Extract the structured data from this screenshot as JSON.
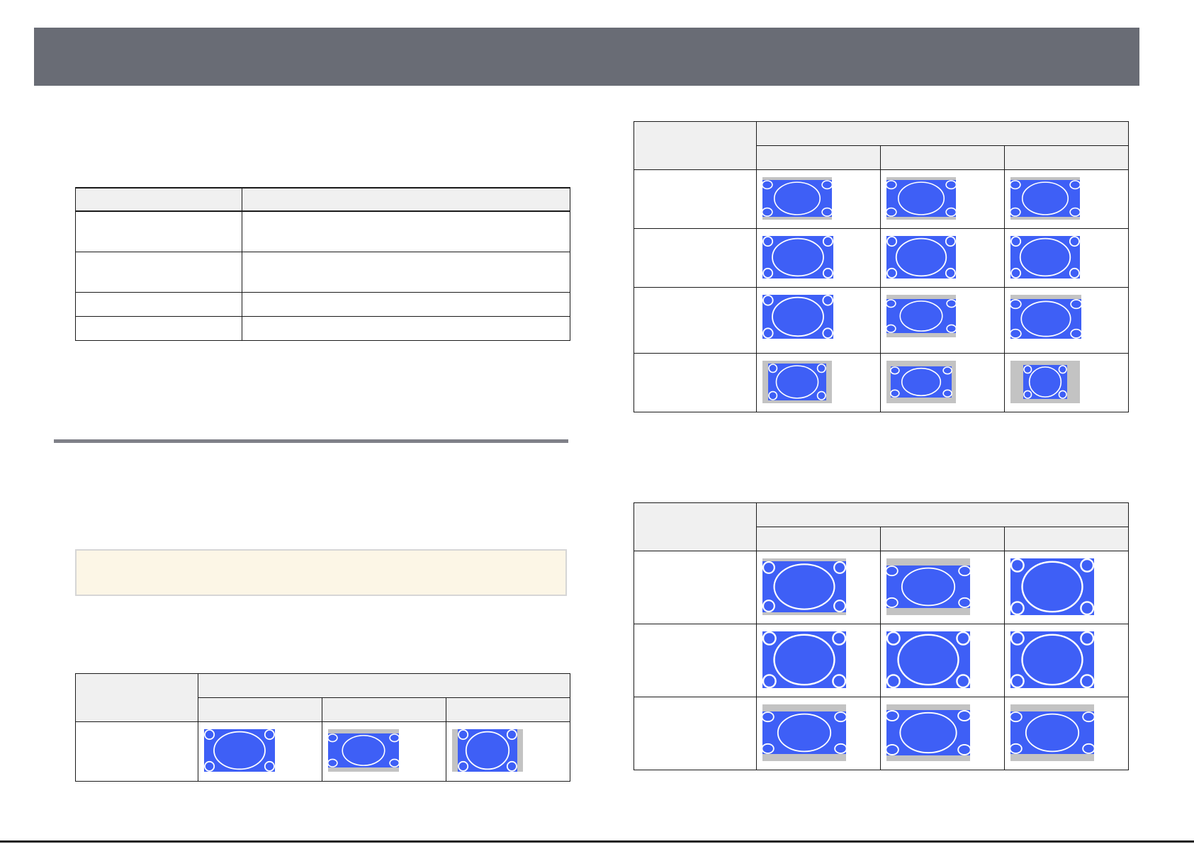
{
  "colors": {
    "header_bar": "#696c75",
    "rule": "#7f8088",
    "note_background": "#fcf6e6",
    "table_header_fill": "#f0f0f0",
    "screen_blue": "#3e5ff6",
    "letterbox_gray": "#c3c3c3",
    "outline_white": "#ffffff"
  },
  "thumbnail": {
    "icon": "aspect-ratio-test-pattern-icon"
  }
}
